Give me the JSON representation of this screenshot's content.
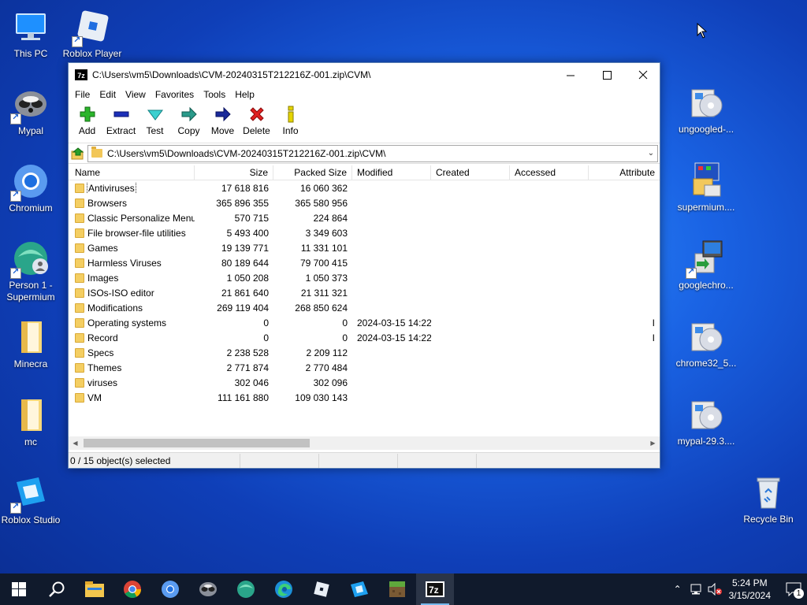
{
  "desktop": {
    "left_icons": [
      {
        "name": "This PC"
      },
      {
        "name": "Roblox Player"
      },
      {
        "name": "Mypal"
      },
      {
        "name": "Chromium"
      },
      {
        "name": "Person 1 - Supermium"
      },
      {
        "name": "Minecra"
      },
      {
        "name": "mc"
      },
      {
        "name": "Roblox Studio"
      }
    ],
    "right_icons": [
      {
        "name": "ungoogled-..."
      },
      {
        "name": "supermium...."
      },
      {
        "name": "googlechro..."
      },
      {
        "name": "chrome32_5..."
      },
      {
        "name": "mypal-29.3...."
      },
      {
        "name": "Recycle Bin"
      }
    ]
  },
  "window": {
    "app_icon": "7z",
    "title": "C:\\Users\\vm5\\Downloads\\CVM-20240315T212216Z-001.zip\\CVM\\",
    "menu": [
      "File",
      "Edit",
      "View",
      "Favorites",
      "Tools",
      "Help"
    ],
    "toolbar": [
      "Add",
      "Extract",
      "Test",
      "Copy",
      "Move",
      "Delete",
      "Info"
    ],
    "address": "C:\\Users\\vm5\\Downloads\\CVM-20240315T212216Z-001.zip\\CVM\\",
    "columns": {
      "name": "Name",
      "size": "Size",
      "packed": "Packed Size",
      "modified": "Modified",
      "created": "Created",
      "accessed": "Accessed",
      "attributes": "Attribute"
    },
    "rows": [
      {
        "name": "Antiviruses",
        "size": "17 618 816",
        "packed": "16 060 362",
        "modified": "",
        "attr": ""
      },
      {
        "name": "Browsers",
        "size": "365 896 355",
        "packed": "365 580 956",
        "modified": "",
        "attr": ""
      },
      {
        "name": "Classic Personalize Menu",
        "size": "570 715",
        "packed": "224 864",
        "modified": "",
        "attr": ""
      },
      {
        "name": "File browser-file utilities",
        "size": "5 493 400",
        "packed": "3 349 603",
        "modified": "",
        "attr": ""
      },
      {
        "name": "Games",
        "size": "19 139 771",
        "packed": "11 331 101",
        "modified": "",
        "attr": ""
      },
      {
        "name": "Harmless Viruses",
        "size": "80 189 644",
        "packed": "79 700 415",
        "modified": "",
        "attr": ""
      },
      {
        "name": "Images",
        "size": "1 050 208",
        "packed": "1 050 373",
        "modified": "",
        "attr": ""
      },
      {
        "name": "ISOs-ISO editor",
        "size": "21 861 640",
        "packed": "21 311 321",
        "modified": "",
        "attr": ""
      },
      {
        "name": "Modifications",
        "size": "269 119 404",
        "packed": "268 850 624",
        "modified": "",
        "attr": ""
      },
      {
        "name": "Operating systems",
        "size": "0",
        "packed": "0",
        "modified": "2024-03-15 14:22",
        "attr": "I"
      },
      {
        "name": "Record",
        "size": "0",
        "packed": "0",
        "modified": "2024-03-15 14:22",
        "attr": "I"
      },
      {
        "name": "Specs",
        "size": "2 238 528",
        "packed": "2 209 112",
        "modified": "",
        "attr": ""
      },
      {
        "name": "Themes",
        "size": "2 771 874",
        "packed": "2 770 484",
        "modified": "",
        "attr": ""
      },
      {
        "name": "viruses",
        "size": "302 046",
        "packed": "302 096",
        "modified": "",
        "attr": ""
      },
      {
        "name": "VM",
        "size": "111 161 880",
        "packed": "109 030 143",
        "modified": "",
        "attr": ""
      }
    ],
    "status": "0 / 15 object(s) selected"
  },
  "taskbar": {
    "time": "5:24 PM",
    "date": "3/15/2024",
    "notification_count": "1",
    "pinned": [
      "start-icon",
      "search-icon",
      "file-explorer-icon",
      "chrome-icon",
      "chromium-icon",
      "mypal-icon",
      "supermium-icon",
      "edge-icon",
      "roblox-player-icon",
      "roblox-studio-icon",
      "minecraft-icon",
      "7zip-icon"
    ]
  },
  "colors": {
    "accent": "#0078d7",
    "taskbar": "#101a2c",
    "folder": "#f4ce62"
  }
}
